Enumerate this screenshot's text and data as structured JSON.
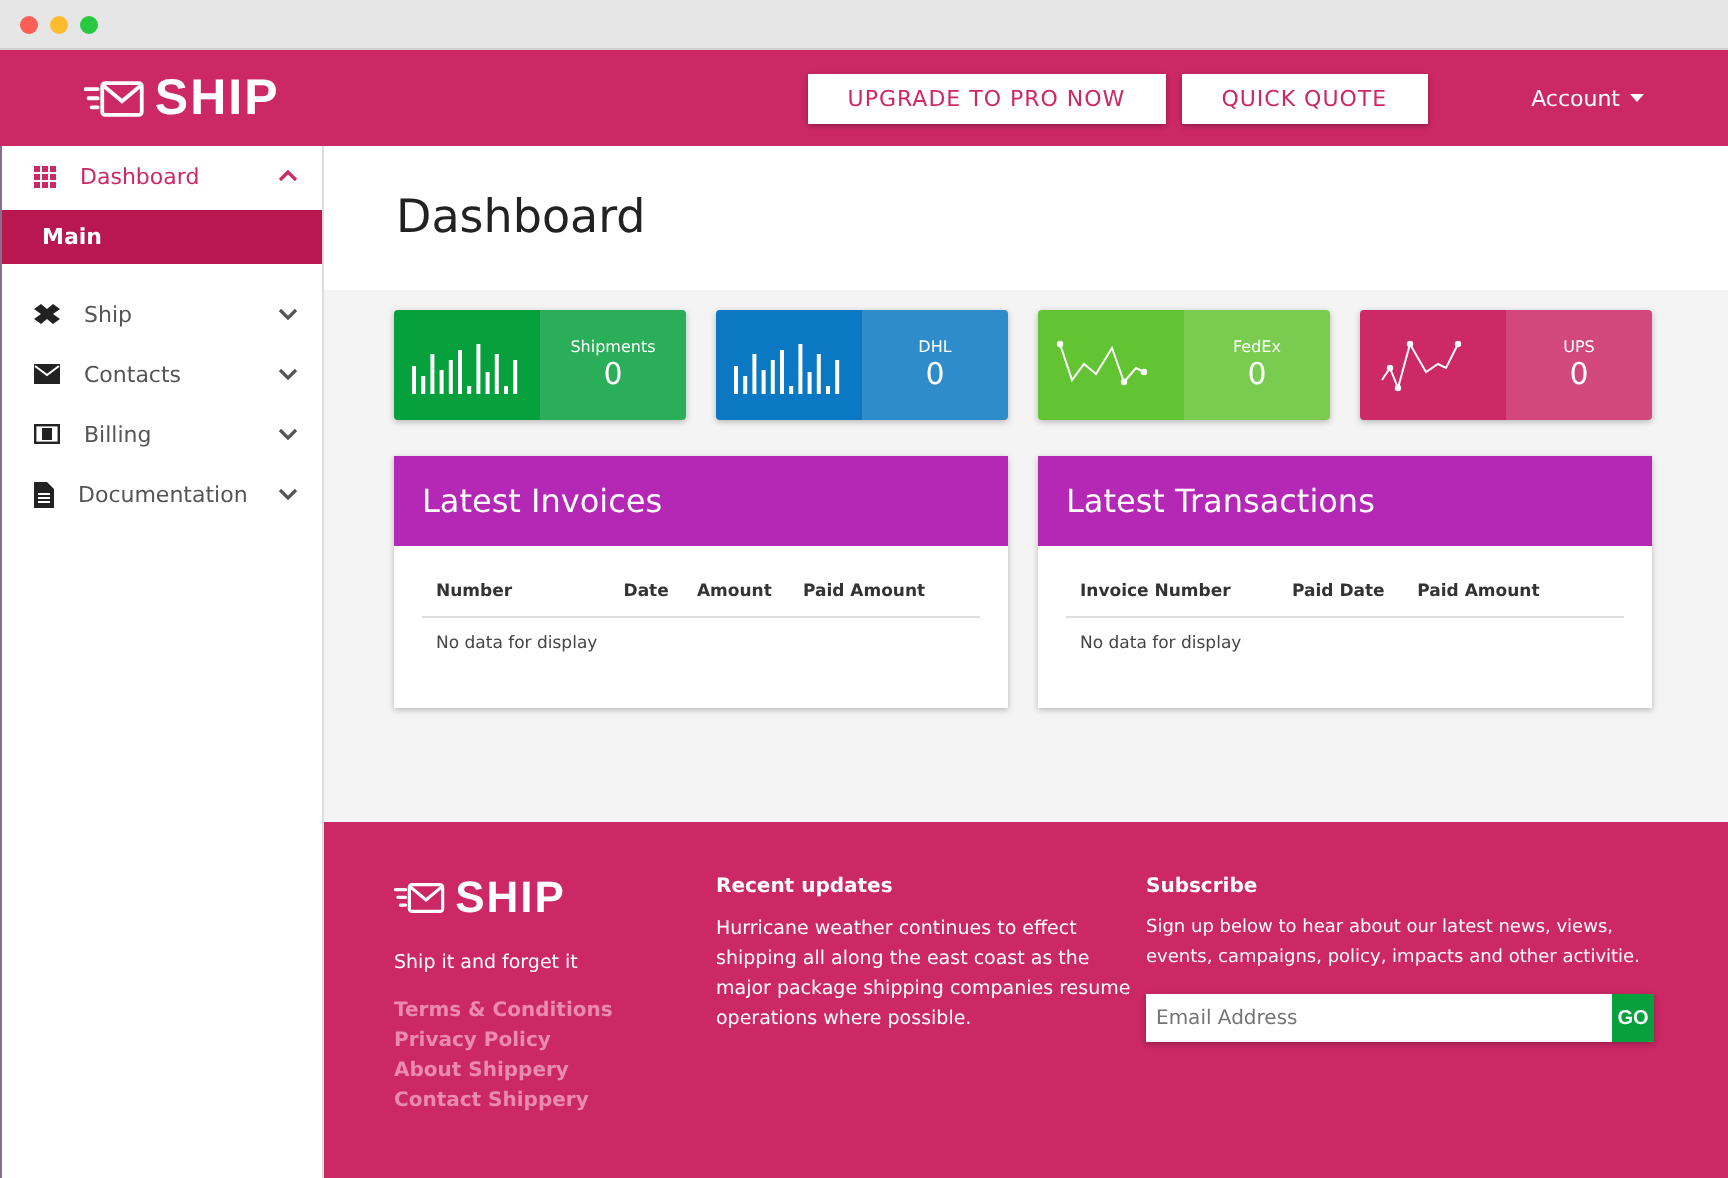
{
  "header": {
    "logo": "SHIP",
    "buttons": [
      "UPGRADE TO PRO NOW",
      "QUICK QUOTE"
    ],
    "account": "Account"
  },
  "sidebar": {
    "items": [
      {
        "label": "Dashboard",
        "selected": true,
        "expanded": true,
        "children": [
          {
            "label": "Main",
            "selected": true
          }
        ]
      },
      {
        "label": "Ship",
        "selected": false,
        "expanded": false
      },
      {
        "label": "Contacts",
        "selected": false,
        "expanded": false
      },
      {
        "label": "Billing",
        "selected": false,
        "expanded": false
      },
      {
        "label": "Documentation",
        "selected": false,
        "expanded": false
      }
    ]
  },
  "page": {
    "title": "Dashboard"
  },
  "stats": [
    {
      "label": "Shipments",
      "value": "0",
      "color": "#06a03c",
      "kind": "bars"
    },
    {
      "label": "DHL",
      "value": "0",
      "color": "#0a78c2",
      "kind": "bars"
    },
    {
      "label": "FedEx",
      "value": "0",
      "color": "#62c432",
      "kind": "line"
    },
    {
      "label": "UPS",
      "value": "0",
      "color": "#cc2966",
      "kind": "line"
    }
  ],
  "panels": [
    {
      "title": "Latest Invoices",
      "columns": [
        "Number",
        "Date",
        "Amount",
        "Paid Amount"
      ],
      "empty": "No data for display"
    },
    {
      "title": "Latest Transactions",
      "columns": [
        "Invoice Number",
        "Paid Date",
        "Paid Amount"
      ],
      "empty": "No data for display"
    }
  ],
  "footer": {
    "logo": "SHIP",
    "tagline": "Ship it and forget it",
    "links": [
      "Terms & Conditions",
      "Privacy Policy",
      "About Shippery",
      "Contact Shippery"
    ],
    "updates": {
      "heading": "Recent updates",
      "text": "Hurricane weather continues to effect shipping all along the east coast as the major package shipping companies resume operations where possible."
    },
    "subscribe": {
      "heading": "Subscribe",
      "text": "Sign up below to hear about our latest news, views, events, campaigns, policy, impacts and other activitie.",
      "placeholder": "Email Address",
      "button": "GO"
    }
  }
}
